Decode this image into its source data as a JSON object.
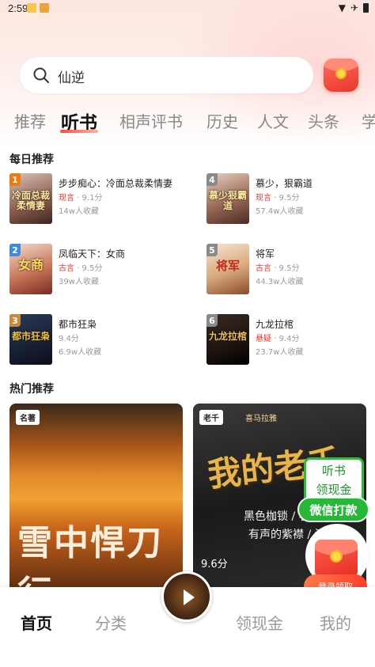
{
  "status_bar": {
    "time": "2:59"
  },
  "search": {
    "query": "仙逆"
  },
  "tabs": [
    "推荐",
    "听书",
    "相声评书",
    "历史",
    "人文",
    "头条",
    "学"
  ],
  "daily": {
    "title": "每日推荐",
    "books": [
      {
        "rank": "1",
        "title": "步步痴心：冷面总裁柔情妻",
        "genre": "现言",
        "score": "9.1分",
        "fav": "14w人收藏",
        "cover_text": "冷面总裁柔情妻",
        "rank_color": "#f07a10"
      },
      {
        "rank": "4",
        "title": "慕少，狠霸道",
        "genre": "现言",
        "score": "9.5分",
        "fav": "57.4w人收藏",
        "cover_text": "慕少狠霸道",
        "rank_color": "#8a8a8a"
      },
      {
        "rank": "2",
        "title": "凤临天下：女商",
        "genre": "古言",
        "score": "9.5分",
        "fav": "39w人收藏",
        "cover_text": "女商",
        "rank_color": "#3f8bd8"
      },
      {
        "rank": "5",
        "title": "将军",
        "genre": "古言",
        "score": "9.5分",
        "fav": "44.3w人收藏",
        "cover_text": "将军",
        "rank_color": "#8a8a8a"
      },
      {
        "rank": "3",
        "title": "都市狂枭",
        "genre": "",
        "score": "9.4分",
        "fav": "6.9w人收藏",
        "cover_text": "都市狂枭",
        "rank_color": "#c98a3a"
      },
      {
        "rank": "6",
        "title": "九龙拉棺",
        "genre": "悬疑",
        "score": "9.4分",
        "fav": "23.7w人收藏",
        "cover_text": "九龙拉棺",
        "rank_color": "#8a8a8a"
      }
    ]
  },
  "hot": {
    "title": "热门推荐",
    "cards": [
      {
        "tag": "名著",
        "cover_text": "雪中悍刀行",
        "score": ""
      },
      {
        "tag": "老千",
        "cover_text": "我的老千",
        "line1": "黑色枷锁 / 著",
        "line2": "有声的紫襟 / 演",
        "brand": "喜马拉雅",
        "score": "9.6分"
      }
    ]
  },
  "floating": {
    "line1": "听书",
    "line2": "领现金",
    "wechat": "微信打款",
    "login": "登录领取"
  },
  "bottom_nav": [
    "首页",
    "分类",
    "领现金",
    "我的"
  ],
  "colors": {
    "accent": "#e8372d",
    "wechat_green": "#27b83a"
  }
}
